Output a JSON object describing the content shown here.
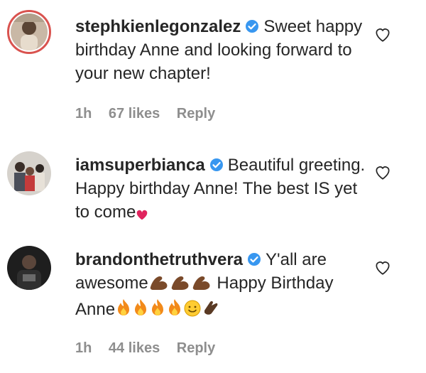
{
  "comments": [
    {
      "username": "stephkienlegonzalez",
      "text": "Sweet happy birthday Anne and looking forward to your new chapter!",
      "time": "1h",
      "likes": "67 likes",
      "reply": "Reply",
      "icons": [
        "verified-badge-icon",
        "heart-outline-icon"
      ]
    },
    {
      "username": "iamsuperbianca",
      "text": "Beautiful greeting. Happy birthday Anne! The best IS yet to come",
      "emoji": [
        "red-heart"
      ],
      "icons": [
        "verified-badge-icon",
        "heart-outline-icon"
      ]
    },
    {
      "username": "brandonthetruthvera",
      "text_before_emoji": "Y'all are awesome",
      "emoji_muscle": [
        "flexed-biceps",
        "flexed-biceps",
        "flexed-biceps"
      ],
      "text_after_muscle": "Happy Birthday Anne",
      "emoji_trailing": [
        "fire",
        "fire",
        "fire",
        "fire",
        "smiling-face",
        "clapping-hands"
      ],
      "time": "1h",
      "likes": "44 likes",
      "reply": "Reply",
      "icons": [
        "verified-badge-icon",
        "heart-outline-icon"
      ]
    }
  ],
  "colors": {
    "text": "#262626",
    "meta": "#8e8e8e",
    "verified": "#3897f0",
    "story_ring": "#d9534f",
    "heart_emoji": "#e0245e"
  }
}
